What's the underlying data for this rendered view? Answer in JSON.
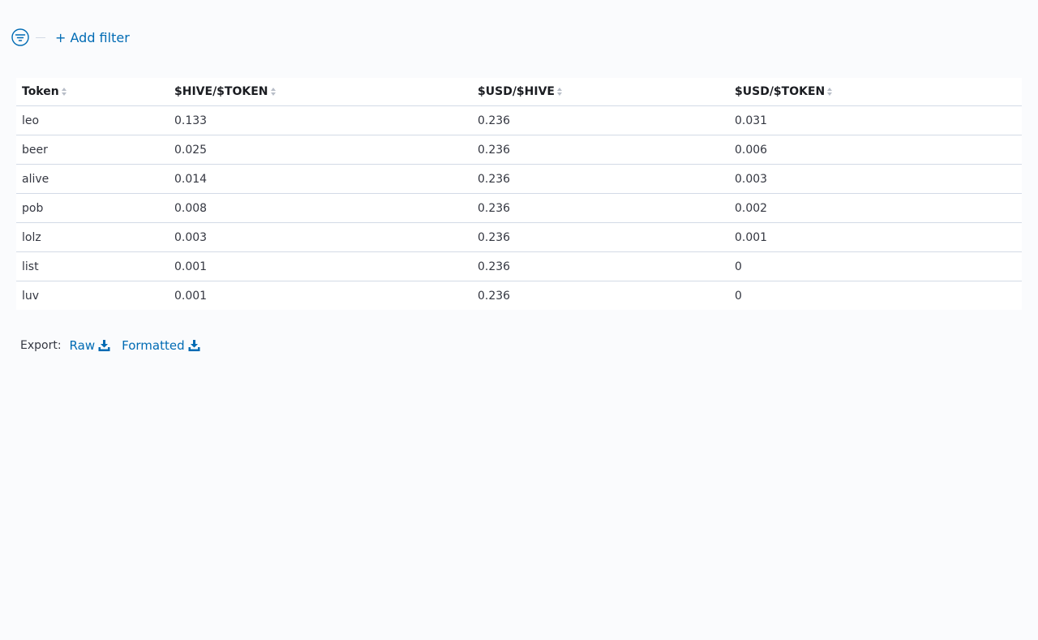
{
  "filter_bar": {
    "add_filter_label": "+ Add filter",
    "icon": "filter-icon"
  },
  "table": {
    "columns": [
      "Token",
      "$HIVE/$TOKEN",
      "$USD/$HIVE",
      "$USD/$TOKEN"
    ],
    "rows": [
      [
        "leo",
        "0.133",
        "0.236",
        "0.031"
      ],
      [
        "beer",
        "0.025",
        "0.236",
        "0.006"
      ],
      [
        "alive",
        "0.014",
        "0.236",
        "0.003"
      ],
      [
        "pob",
        "0.008",
        "0.236",
        "0.002"
      ],
      [
        "lolz",
        "0.003",
        "0.236",
        "0.001"
      ],
      [
        "list",
        "0.001",
        "0.236",
        "0"
      ],
      [
        "luv",
        "0.001",
        "0.236",
        "0"
      ]
    ]
  },
  "export": {
    "label": "Export:",
    "raw_label": "Raw",
    "formatted_label": "Formatted",
    "icon": "download-icon"
  },
  "colors": {
    "background": "#fafbfd",
    "link": "#006bb4",
    "border": "#d3dae6"
  }
}
